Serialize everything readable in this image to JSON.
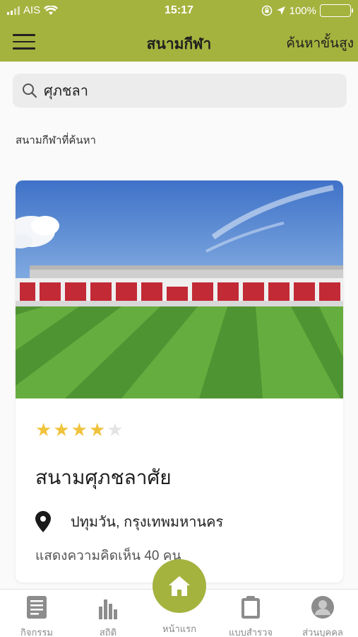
{
  "status": {
    "carrier": "AIS",
    "time": "15:17",
    "battery": "100%",
    "battery_level": 1.0
  },
  "header": {
    "title": "สนามกีฬา",
    "advanced_search": "ค้นหาขั้นสูง"
  },
  "search": {
    "value": "ศุภชลา",
    "placeholder": ""
  },
  "section": {
    "label": "สนามกีฬาที่ค้นหา"
  },
  "results": [
    {
      "rating": 4,
      "rating_max": 5,
      "name": "สนามศุภชลาศัย",
      "location": "ปทุมวัน, กรุงเทพมหานคร",
      "comments": "แสดงความคิดเห็น 40 คน"
    }
  ],
  "tabs": {
    "activities": "กิจกรรม",
    "stats": "สถิติ",
    "home": "หน้าแรก",
    "survey": "แบบสำรวจ",
    "profile": "ส่วนบุคคล"
  },
  "colors": {
    "brand": "#a4b33e",
    "star": "#f0c33c"
  }
}
